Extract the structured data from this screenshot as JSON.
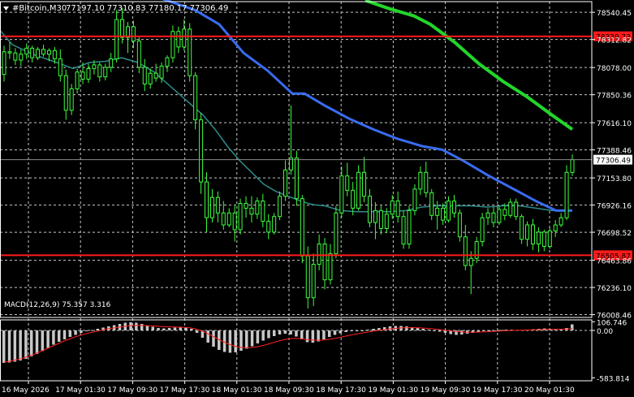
{
  "header": {
    "symbol": "#Bitcoin,M30",
    "ohlc": "77197.10 77310.83 77180.17 77306.49"
  },
  "colors": {
    "background": "#000000",
    "grid": "#c8c8c8",
    "candle": "#3cff3c",
    "ma_fast": "#2e8b8b",
    "ma_mid": "#3a6cf0",
    "ma_slow": "#22d62a",
    "level": "#ff1a1a",
    "macd_hist": "#c8c8c8",
    "macd_signal": "#ff2020",
    "text": "#ffffff"
  },
  "chart_data": [
    {
      "type": "candlestick",
      "price_axis_ticks": [
        78540.45,
        78312.82,
        78078.0,
        77850.36,
        77616.1,
        77388.46,
        77153.8,
        76926.16,
        76698.52,
        76463.86,
        76236.1,
        76008.46
      ],
      "ylim": [
        75985.0,
        78630.0
      ],
      "time_axis_labels": [
        "16 May 2026",
        "17 May 01:30",
        "17 May 09:30",
        "17 May 17:30",
        "18 May 01:30",
        "18 May 09:30",
        "18 May 17:30",
        "19 May 01:30",
        "19 May 09:30",
        "19 May 17:30",
        "20 May 01:30"
      ],
      "current_price": 77306.49,
      "levels": [
        {
          "label": "78339.73",
          "value": 78339.73
        },
        {
          "label": "76505.87",
          "value": 76505.87
        }
      ],
      "ma_fast": [
        [
          0,
          78390
        ],
        [
          15,
          78270
        ],
        [
          40,
          78190
        ],
        [
          70,
          78120
        ],
        [
          90,
          78070
        ],
        [
          110,
          78120
        ],
        [
          130,
          78130
        ],
        [
          150,
          78160
        ],
        [
          170,
          78120
        ],
        [
          190,
          78040
        ],
        [
          210,
          77920
        ],
        [
          230,
          77800
        ],
        [
          250,
          77680
        ],
        [
          265,
          77560
        ],
        [
          280,
          77420
        ],
        [
          295,
          77300
        ],
        [
          310,
          77200
        ],
        [
          325,
          77100
        ],
        [
          340,
          77040
        ],
        [
          355,
          77000
        ],
        [
          370,
          76960
        ],
        [
          385,
          76930
        ],
        [
          400,
          76920
        ],
        [
          420,
          76880
        ],
        [
          440,
          76870
        ],
        [
          460,
          76870
        ],
        [
          480,
          76870
        ],
        [
          500,
          76880
        ],
        [
          520,
          76910
        ],
        [
          540,
          76920
        ],
        [
          560,
          76920
        ],
        [
          580,
          76920
        ],
        [
          600,
          76910
        ],
        [
          620,
          76920
        ],
        [
          640,
          76920
        ],
        [
          660,
          76900
        ],
        [
          680,
          76880
        ],
        [
          700,
          76880
        ]
      ],
      "ma_mid": [
        [
          0,
          78890
        ],
        [
          100,
          78780
        ],
        [
          180,
          78700
        ],
        [
          240,
          78560
        ],
        [
          270,
          78440
        ],
        [
          300,
          78200
        ],
        [
          330,
          78050
        ],
        [
          360,
          77860
        ],
        [
          375,
          77860
        ],
        [
          400,
          77760
        ],
        [
          430,
          77650
        ],
        [
          460,
          77560
        ],
        [
          490,
          77480
        ],
        [
          520,
          77420
        ],
        [
          545,
          77390
        ],
        [
          570,
          77300
        ],
        [
          600,
          77180
        ],
        [
          630,
          77070
        ],
        [
          660,
          76960
        ],
        [
          685,
          76880
        ],
        [
          705,
          76880
        ]
      ],
      "ma_slow": [
        [
          450,
          78640
        ],
        [
          480,
          78570
        ],
        [
          510,
          78510
        ],
        [
          530,
          78440
        ],
        [
          560,
          78290
        ],
        [
          590,
          78110
        ],
        [
          620,
          77960
        ],
        [
          650,
          77830
        ],
        [
          680,
          77680
        ],
        [
          705,
          77560
        ]
      ],
      "candles": [
        {
          "o": 78020,
          "h": 78260,
          "l": 77960,
          "c": 78210
        },
        {
          "o": 78210,
          "h": 78290,
          "l": 78150,
          "c": 78200
        },
        {
          "o": 78200,
          "h": 78240,
          "l": 78100,
          "c": 78140
        },
        {
          "o": 78140,
          "h": 78230,
          "l": 78090,
          "c": 78190
        },
        {
          "o": 78190,
          "h": 78280,
          "l": 78150,
          "c": 78240
        },
        {
          "o": 78240,
          "h": 78260,
          "l": 78120,
          "c": 78160
        },
        {
          "o": 78160,
          "h": 78250,
          "l": 78140,
          "c": 78230
        },
        {
          "o": 78230,
          "h": 78270,
          "l": 78170,
          "c": 78190
        },
        {
          "o": 78190,
          "h": 78240,
          "l": 78130,
          "c": 78220
        },
        {
          "o": 78220,
          "h": 78250,
          "l": 78110,
          "c": 78150
        },
        {
          "o": 78150,
          "h": 78230,
          "l": 77960,
          "c": 78010
        },
        {
          "o": 78010,
          "h": 78060,
          "l": 77640,
          "c": 77720
        },
        {
          "o": 77720,
          "h": 77940,
          "l": 77680,
          "c": 77900
        },
        {
          "o": 77900,
          "h": 78070,
          "l": 77860,
          "c": 78040
        },
        {
          "o": 78040,
          "h": 78120,
          "l": 77940,
          "c": 77980
        },
        {
          "o": 77980,
          "h": 78110,
          "l": 77950,
          "c": 78070
        },
        {
          "o": 78070,
          "h": 78140,
          "l": 78020,
          "c": 78100
        },
        {
          "o": 78100,
          "h": 78120,
          "l": 77960,
          "c": 78000
        },
        {
          "o": 78000,
          "h": 78110,
          "l": 77970,
          "c": 78080
        },
        {
          "o": 78080,
          "h": 78200,
          "l": 78040,
          "c": 78150
        },
        {
          "o": 78150,
          "h": 78560,
          "l": 78120,
          "c": 78480
        },
        {
          "o": 78480,
          "h": 78580,
          "l": 78280,
          "c": 78330
        },
        {
          "o": 78330,
          "h": 78460,
          "l": 78200,
          "c": 78420
        },
        {
          "o": 78420,
          "h": 78470,
          "l": 78240,
          "c": 78300
        },
        {
          "o": 78300,
          "h": 78330,
          "l": 78030,
          "c": 78080
        },
        {
          "o": 78080,
          "h": 78150,
          "l": 77880,
          "c": 77940
        },
        {
          "o": 77940,
          "h": 78070,
          "l": 77900,
          "c": 78030
        },
        {
          "o": 78030,
          "h": 78110,
          "l": 77960,
          "c": 77990
        },
        {
          "o": 77990,
          "h": 78120,
          "l": 77950,
          "c": 78090
        },
        {
          "o": 78090,
          "h": 78180,
          "l": 78040,
          "c": 78160
        },
        {
          "o": 78160,
          "h": 78430,
          "l": 78120,
          "c": 78380
        },
        {
          "o": 78380,
          "h": 78420,
          "l": 78200,
          "c": 78250
        },
        {
          "o": 78250,
          "h": 78480,
          "l": 78220,
          "c": 78400
        },
        {
          "o": 78400,
          "h": 78450,
          "l": 77960,
          "c": 78010
        },
        {
          "o": 78010,
          "h": 78040,
          "l": 77560,
          "c": 77640
        },
        {
          "o": 77640,
          "h": 77700,
          "l": 77020,
          "c": 77120
        },
        {
          "o": 77120,
          "h": 77200,
          "l": 76700,
          "c": 76820
        },
        {
          "o": 76820,
          "h": 77060,
          "l": 76780,
          "c": 76990
        },
        {
          "o": 76990,
          "h": 77040,
          "l": 76780,
          "c": 76860
        },
        {
          "o": 76860,
          "h": 76960,
          "l": 76720,
          "c": 76760
        },
        {
          "o": 76760,
          "h": 76900,
          "l": 76740,
          "c": 76860
        },
        {
          "o": 76860,
          "h": 76920,
          "l": 76620,
          "c": 76720
        },
        {
          "o": 76720,
          "h": 76980,
          "l": 76680,
          "c": 76940
        },
        {
          "o": 76940,
          "h": 77000,
          "l": 76820,
          "c": 76900
        },
        {
          "o": 76900,
          "h": 77000,
          "l": 76780,
          "c": 76850
        },
        {
          "o": 76850,
          "h": 76990,
          "l": 76810,
          "c": 76960
        },
        {
          "o": 76960,
          "h": 77020,
          "l": 76740,
          "c": 76790
        },
        {
          "o": 76790,
          "h": 76850,
          "l": 76640,
          "c": 76700
        },
        {
          "o": 76700,
          "h": 76860,
          "l": 76680,
          "c": 76830
        },
        {
          "o": 76830,
          "h": 77040,
          "l": 76800,
          "c": 77000
        },
        {
          "o": 77000,
          "h": 77300,
          "l": 76960,
          "c": 77220
        },
        {
          "o": 77220,
          "h": 77760,
          "l": 77180,
          "c": 77320
        },
        {
          "o": 77320,
          "h": 77380,
          "l": 76920,
          "c": 76980
        },
        {
          "o": 76980,
          "h": 77010,
          "l": 76440,
          "c": 76500
        },
        {
          "o": 76500,
          "h": 76580,
          "l": 76060,
          "c": 76150
        },
        {
          "o": 76150,
          "h": 76520,
          "l": 76080,
          "c": 76430
        },
        {
          "o": 76430,
          "h": 76680,
          "l": 76380,
          "c": 76600
        },
        {
          "o": 76600,
          "h": 76650,
          "l": 76220,
          "c": 76300
        },
        {
          "o": 76300,
          "h": 76600,
          "l": 76260,
          "c": 76520
        },
        {
          "o": 76520,
          "h": 76920,
          "l": 76480,
          "c": 76860
        },
        {
          "o": 76860,
          "h": 77250,
          "l": 76820,
          "c": 77170
        },
        {
          "o": 77170,
          "h": 77280,
          "l": 77000,
          "c": 77050
        },
        {
          "o": 77050,
          "h": 77120,
          "l": 76840,
          "c": 76900
        },
        {
          "o": 76900,
          "h": 77260,
          "l": 76880,
          "c": 77200
        },
        {
          "o": 77200,
          "h": 77330,
          "l": 76950,
          "c": 77000
        },
        {
          "o": 77000,
          "h": 77060,
          "l": 76740,
          "c": 76780
        },
        {
          "o": 76780,
          "h": 76950,
          "l": 76640,
          "c": 76880
        },
        {
          "o": 76880,
          "h": 76920,
          "l": 76680,
          "c": 76730
        },
        {
          "o": 76730,
          "h": 76900,
          "l": 76690,
          "c": 76850
        },
        {
          "o": 76850,
          "h": 77010,
          "l": 76810,
          "c": 76960
        },
        {
          "o": 76960,
          "h": 77040,
          "l": 76780,
          "c": 76830
        },
        {
          "o": 76830,
          "h": 76880,
          "l": 76560,
          "c": 76600
        },
        {
          "o": 76600,
          "h": 76920,
          "l": 76560,
          "c": 76880
        },
        {
          "o": 76880,
          "h": 77100,
          "l": 76840,
          "c": 77060
        },
        {
          "o": 77060,
          "h": 77250,
          "l": 77010,
          "c": 77200
        },
        {
          "o": 77200,
          "h": 77290,
          "l": 76990,
          "c": 77030
        },
        {
          "o": 77030,
          "h": 77060,
          "l": 76800,
          "c": 76840
        },
        {
          "o": 76840,
          "h": 76960,
          "l": 76720,
          "c": 76900
        },
        {
          "o": 76900,
          "h": 76940,
          "l": 76760,
          "c": 76800
        },
        {
          "o": 76800,
          "h": 77000,
          "l": 76780,
          "c": 76960
        },
        {
          "o": 76960,
          "h": 77010,
          "l": 76820,
          "c": 76860
        },
        {
          "o": 76860,
          "h": 76890,
          "l": 76620,
          "c": 76660
        },
        {
          "o": 76660,
          "h": 76760,
          "l": 76380,
          "c": 76420
        },
        {
          "o": 76420,
          "h": 76540,
          "l": 76180,
          "c": 76480
        },
        {
          "o": 76480,
          "h": 76660,
          "l": 76440,
          "c": 76620
        },
        {
          "o": 76620,
          "h": 76860,
          "l": 76580,
          "c": 76820
        },
        {
          "o": 76820,
          "h": 76900,
          "l": 76760,
          "c": 76860
        },
        {
          "o": 76860,
          "h": 76910,
          "l": 76740,
          "c": 76780
        },
        {
          "o": 76780,
          "h": 76920,
          "l": 76760,
          "c": 76890
        },
        {
          "o": 76890,
          "h": 76940,
          "l": 76800,
          "c": 76840
        },
        {
          "o": 76840,
          "h": 76980,
          "l": 76820,
          "c": 76950
        },
        {
          "o": 76950,
          "h": 76980,
          "l": 76800,
          "c": 76830
        },
        {
          "o": 76830,
          "h": 76850,
          "l": 76600,
          "c": 76640
        },
        {
          "o": 76640,
          "h": 76790,
          "l": 76580,
          "c": 76760
        },
        {
          "o": 76760,
          "h": 76810,
          "l": 76550,
          "c": 76600
        },
        {
          "o": 76600,
          "h": 76740,
          "l": 76530,
          "c": 76700
        },
        {
          "o": 76700,
          "h": 76720,
          "l": 76540,
          "c": 76580
        },
        {
          "o": 76580,
          "h": 76740,
          "l": 76560,
          "c": 76710
        },
        {
          "o": 76710,
          "h": 76800,
          "l": 76660,
          "c": 76760
        },
        {
          "o": 76760,
          "h": 76860,
          "l": 76740,
          "c": 76820
        },
        {
          "o": 76820,
          "h": 77260,
          "l": 76800,
          "c": 77200
        },
        {
          "o": 77200,
          "h": 77350,
          "l": 77170,
          "c": 77306.49
        }
      ]
    },
    {
      "type": "macd",
      "label": "MACD(12,26,9) 75.357 3.316",
      "axis_ticks": [
        106.746,
        0.0,
        -583.814
      ],
      "ylim": [
        -620,
        130
      ],
      "hist": [
        -400,
        -395,
        -385,
        -370,
        -350,
        -320,
        -290,
        -255,
        -215,
        -175,
        -140,
        -110,
        -80,
        -55,
        -30,
        -10,
        5,
        20,
        35,
        50,
        65,
        80,
        95,
        100,
        95,
        80,
        60,
        45,
        30,
        25,
        30,
        35,
        40,
        35,
        20,
        -30,
        -90,
        -150,
        -200,
        -240,
        -265,
        -275,
        -270,
        -250,
        -225,
        -195,
        -160,
        -125,
        -95,
        -70,
        -50,
        -40,
        -50,
        -75,
        -110,
        -145,
        -150,
        -135,
        -110,
        -80,
        -55,
        -35,
        -20,
        -10,
        -5,
        0,
        10,
        20,
        30,
        40,
        50,
        55,
        55,
        50,
        40,
        30,
        20,
        10,
        0,
        -15,
        -30,
        -45,
        -55,
        -50,
        -40,
        -30,
        -20,
        -10,
        -5,
        0,
        5,
        10,
        10,
        5,
        5,
        10,
        15,
        20,
        25,
        20,
        15,
        20,
        30,
        75
      ],
      "signal": [
        -390,
        -380,
        -365,
        -350,
        -330,
        -305,
        -280,
        -250,
        -220,
        -190,
        -160,
        -130,
        -105,
        -80,
        -60,
        -40,
        -25,
        -10,
        5,
        20,
        30,
        40,
        50,
        58,
        62,
        62,
        60,
        56,
        52,
        48,
        45,
        42,
        40,
        38,
        32,
        20,
        0,
        -30,
        -65,
        -100,
        -135,
        -165,
        -190,
        -205,
        -212,
        -212,
        -205,
        -192,
        -175,
        -155,
        -135,
        -118,
        -105,
        -98,
        -100,
        -108,
        -116,
        -120,
        -120,
        -115,
        -105,
        -92,
        -78,
        -64,
        -50,
        -38,
        -26,
        -15,
        -5,
        5,
        14,
        22,
        28,
        32,
        34,
        34,
        32,
        28,
        22,
        15,
        8,
        0,
        -8,
        -15,
        -20,
        -22,
        -22,
        -20,
        -17,
        -14,
        -10,
        -6,
        -3,
        0,
        2,
        4,
        6,
        8,
        10,
        12,
        13,
        14,
        15,
        17,
        22
      ]
    }
  ]
}
